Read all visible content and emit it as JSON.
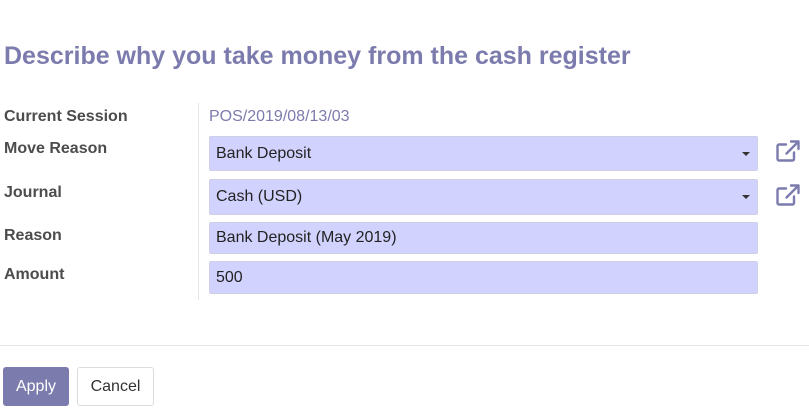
{
  "wizard": {
    "title": "Describe why you take money from the cash register"
  },
  "form": {
    "current_session": {
      "label": "Current Session",
      "value": "POS/2019/08/13/03"
    },
    "move_reason": {
      "label": "Move Reason",
      "value": "Bank Deposit"
    },
    "journal": {
      "label": "Journal",
      "value": "Cash (USD)"
    },
    "reason": {
      "label": "Reason",
      "value": "Bank Deposit (May 2019)"
    },
    "amount": {
      "label": "Amount",
      "value": "500"
    }
  },
  "footer": {
    "apply_label": "Apply",
    "cancel_label": "Cancel"
  },
  "icons": {
    "external_link": "external-link-icon",
    "dropdown": "caret-down-icon"
  },
  "colors": {
    "accent": "#7c7bad",
    "field_background": "#d2d2ff"
  }
}
